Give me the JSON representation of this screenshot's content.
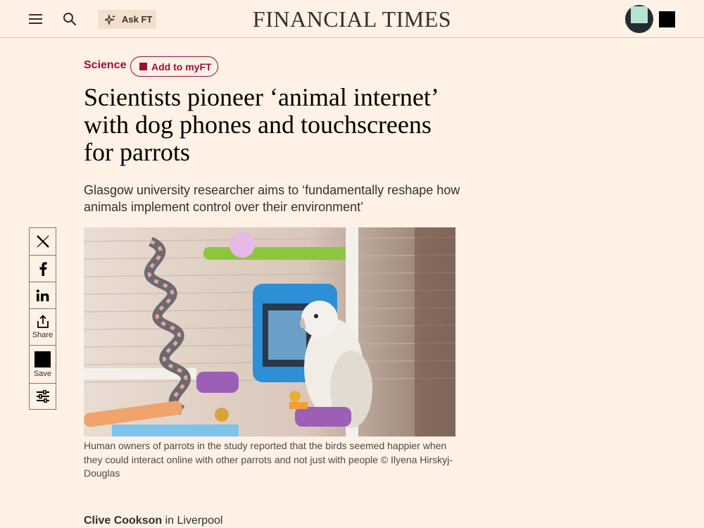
{
  "header": {
    "brand": "FINANCIAL TIMES",
    "askft_label": "Ask FT"
  },
  "article": {
    "topic": "Science",
    "myft_label": "Add to myFT",
    "headline": "Scientists pioneer ‘animal internet’ with dog phones and touchscreens for parrots",
    "standfirst": "Glasgow university researcher aims to ‘fundamentally reshape how animals implement control over their environment’",
    "caption": "Human owners of parrots in the study reported that the birds seemed happier when they could interact online with other parrots and not just with people © Ilyena Hirskyj-Douglas",
    "byline_author": "Clive Cookson",
    "byline_location": " in Liverpool"
  },
  "share_rail": {
    "share_label": "Share",
    "save_label": "Save"
  },
  "colors": {
    "background": "#fff1e5",
    "accent": "#990f3d",
    "text": "#33302e"
  },
  "icons": [
    "menu-icon",
    "search-icon",
    "sparkle-icon",
    "x-icon",
    "facebook-icon",
    "linkedin-icon",
    "share-icon",
    "save-icon",
    "sliders-icon"
  ]
}
